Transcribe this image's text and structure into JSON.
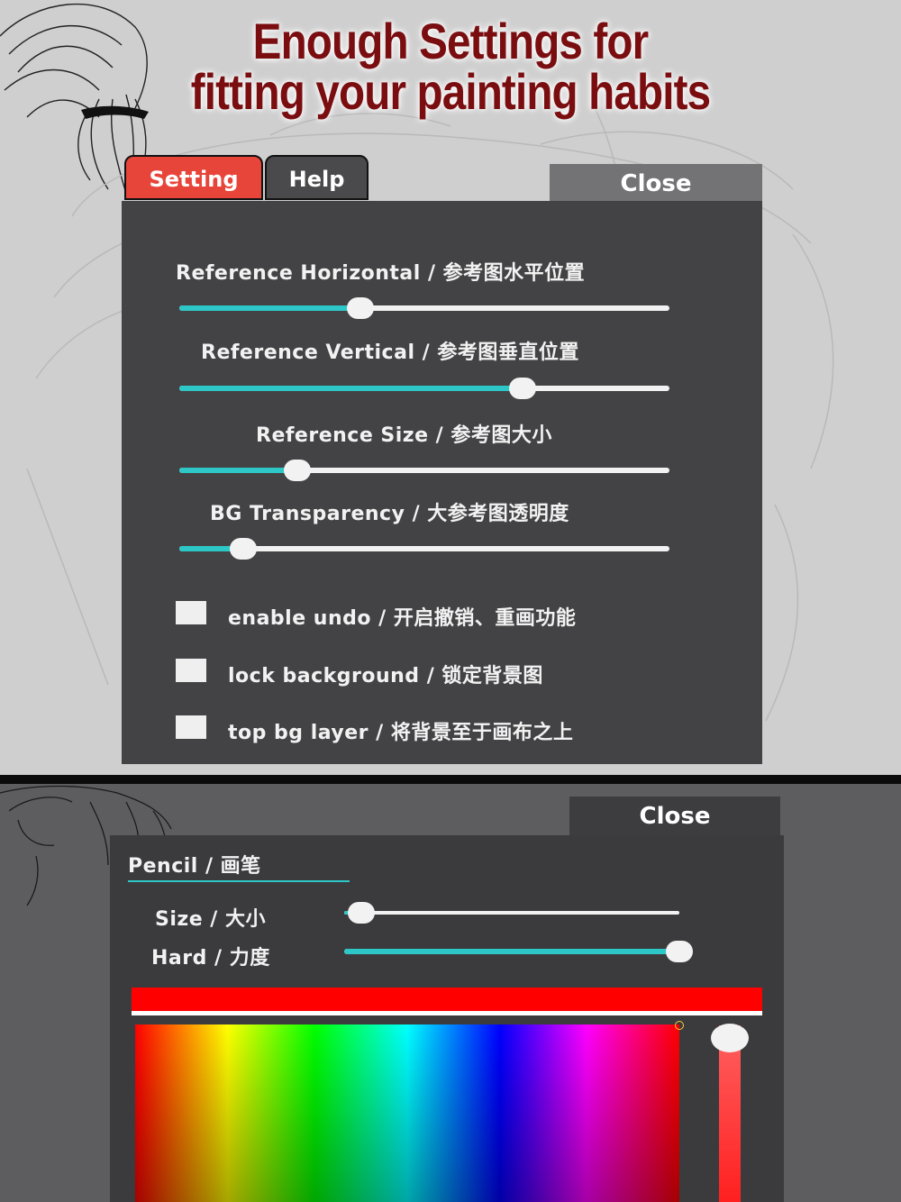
{
  "headline": {
    "line1": "Enough Settings for",
    "line2": "fitting your painting habits"
  },
  "tabs": [
    {
      "label": "Setting",
      "active": true
    },
    {
      "label": "Help",
      "active": false
    }
  ],
  "settings_panel": {
    "close_label": "Close",
    "sliders": [
      {
        "label": "Reference Horizontal / 参考图水平位置",
        "value_percent": 37
      },
      {
        "label": "Reference Vertical / 参考图垂直位置",
        "value_percent": 70
      },
      {
        "label": "Reference Size / 参考图大小",
        "value_percent": 24
      },
      {
        "label": "BG Transparency / 大参考图透明度",
        "value_percent": 13
      }
    ],
    "checkboxes": [
      {
        "label": "enable undo / 开启撤销、重画功能",
        "checked": false
      },
      {
        "label": "lock background / 锁定背景图",
        "checked": false
      },
      {
        "label": "top bg layer / 将背景至于画布之上",
        "checked": false
      }
    ]
  },
  "brush_panel": {
    "close_label": "Close",
    "tool_label": "Pencil / 画笔",
    "sliders": [
      {
        "label": "Size / 大小",
        "value_percent": 5
      },
      {
        "label": "Hard / 力度",
        "value_percent": 100
      }
    ],
    "current_color": "#ff0000"
  },
  "colors": {
    "accent": "#2dc7c7",
    "tab_active": "#e8453a",
    "panel_bg": "#434345",
    "headline": "#7a0d10"
  }
}
